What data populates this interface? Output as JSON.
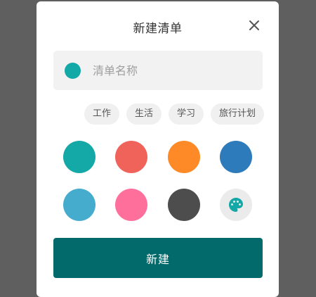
{
  "dialog": {
    "title": "新建清单",
    "close_icon": "close-icon"
  },
  "name_input": {
    "placeholder": "清单名称",
    "value": "",
    "selected_color": "#14a8a6"
  },
  "tags": [
    {
      "label": "工作"
    },
    {
      "label": "生活"
    },
    {
      "label": "学习"
    },
    {
      "label": "旅行计划"
    }
  ],
  "colors": [
    {
      "name": "teal",
      "hex": "#14a8a6"
    },
    {
      "name": "coral",
      "hex": "#f0635a"
    },
    {
      "name": "orange",
      "hex": "#fd8a27"
    },
    {
      "name": "blue",
      "hex": "#2e7bbc"
    },
    {
      "name": "sky-blue",
      "hex": "#45acce"
    },
    {
      "name": "pink",
      "hex": "#ff6f9c"
    },
    {
      "name": "dark-gray",
      "hex": "#4d4d4d"
    }
  ],
  "custom_color": {
    "icon": "palette-icon",
    "icon_color": "#14a8a6"
  },
  "create_button": {
    "label": "新建",
    "color": "#026a6a"
  },
  "theme": {
    "overlay": "#5f5f5f",
    "dialog_bg": "#ffffff"
  }
}
